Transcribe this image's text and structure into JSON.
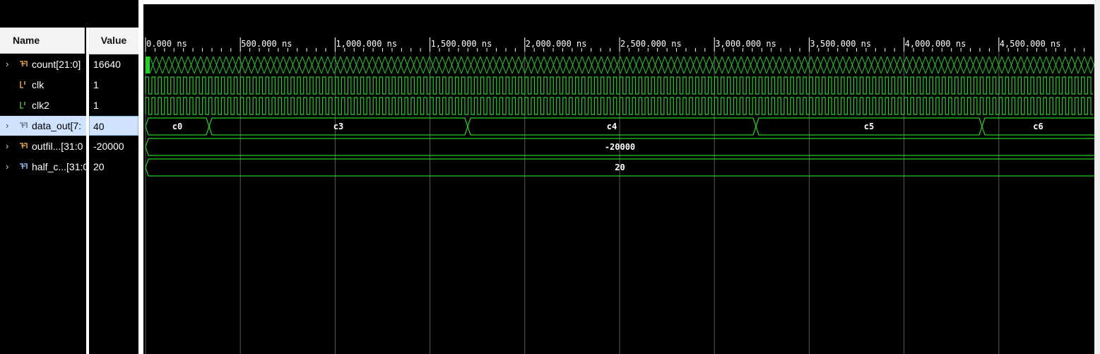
{
  "columns": {
    "name_header": "Name",
    "value_header": "Value"
  },
  "signals": [
    {
      "name": "count[21:0]",
      "value": "16640",
      "expandable": true,
      "icon": "bus-icon"
    },
    {
      "name": "clk",
      "value": "1",
      "expandable": false,
      "icon": "bit-icon"
    },
    {
      "name": "clk2",
      "value": "1",
      "expandable": false,
      "icon": "bit-icon"
    },
    {
      "name": "data_out[7:",
      "value": "40",
      "expandable": true,
      "icon": "bus-icon",
      "selected": true
    },
    {
      "name": "outfil...[31:0",
      "value": "-20000",
      "expandable": true,
      "icon": "bus-icon"
    },
    {
      "name": "half_c...[31:0",
      "value": "20",
      "expandable": true,
      "icon": "bus-icon"
    }
  ],
  "timeline": {
    "ticks": [
      "0.000 ns",
      "500.000 ns",
      "1,000.000 ns",
      "1,500.000 ns",
      "2,000.000 ns",
      "2,500.000 ns",
      "3,000.000 ns",
      "3,500.000 ns",
      "4,000.000 ns",
      "4,500.000 ns"
    ]
  },
  "waves": {
    "data_out_segments": [
      {
        "label": "c0"
      },
      {
        "label": "c3"
      },
      {
        "label": "c4"
      },
      {
        "label": "c5"
      },
      {
        "label": "c6"
      }
    ],
    "outfile_value": "-20000",
    "half_value": "20"
  },
  "colors": {
    "wave": "#1fd31f",
    "background": "#000000",
    "grid": "#5a5a5a",
    "selected": "#cfe3ff"
  }
}
